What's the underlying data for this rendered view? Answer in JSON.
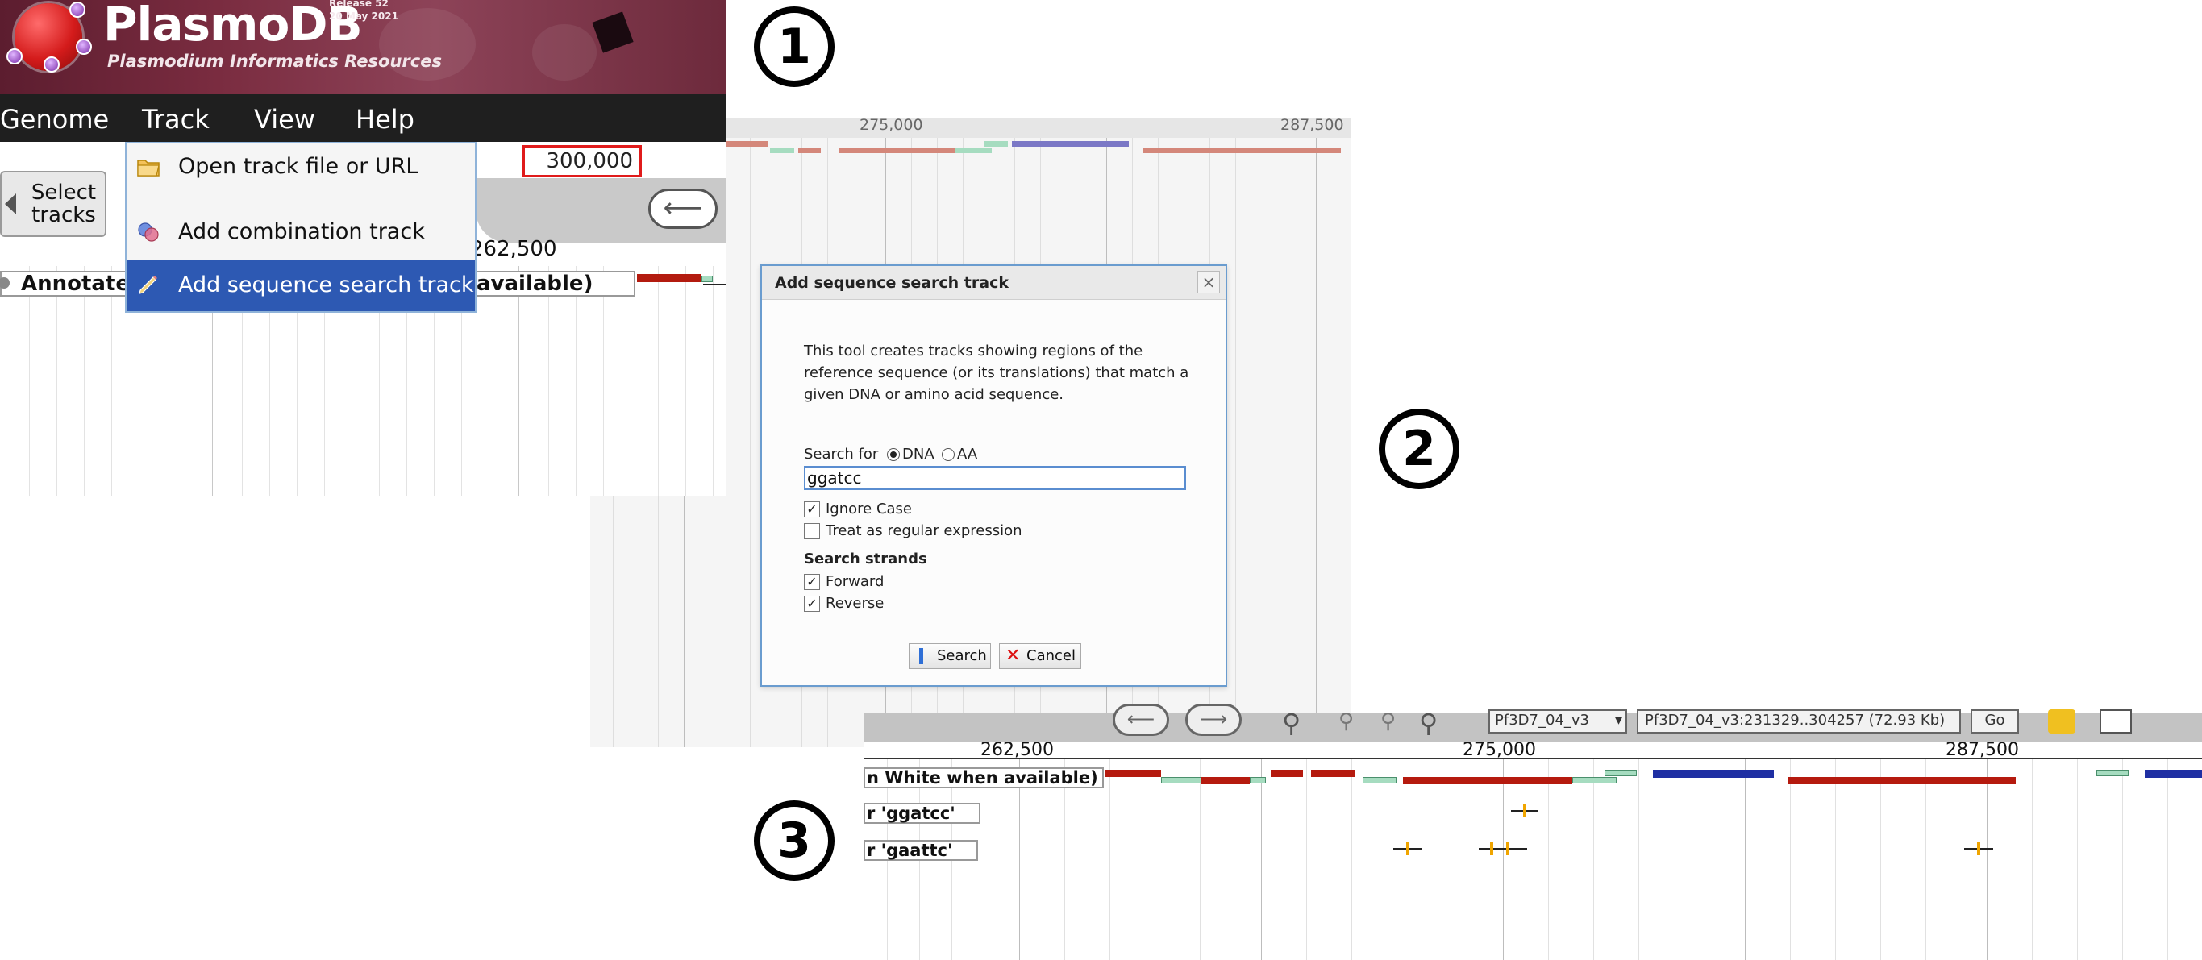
{
  "step_markers": [
    "1",
    "2",
    "3"
  ],
  "panel1": {
    "site": {
      "name": "PlasmoDB",
      "subtitle": "Plasmodium Informatics Resources",
      "release_line1": "Release 52",
      "release_line2": "20 May 2021"
    },
    "menubar": [
      "Genome",
      "Track",
      "View",
      "Help"
    ],
    "track_menu": {
      "items": [
        {
          "label": "Open track file or URL",
          "icon": "folder-icon"
        },
        {
          "label": "Add combination track",
          "icon": "combination-icon"
        },
        {
          "label": "Add sequence search track",
          "icon": "pencil-icon",
          "selected": true
        }
      ]
    },
    "select_tracks_label_1": "Select",
    "select_tracks_label_2": "tracks",
    "location_value": "300,000",
    "ruler_label": "262,500",
    "track_label_left": "Annotated",
    "track_label_right": "available)"
  },
  "panel2": {
    "ruler_ticks": [
      "275,000",
      "287,500"
    ],
    "dialog": {
      "title": "Add sequence search track",
      "close_glyph": "×",
      "description": "This tool creates tracks showing regions of the reference sequence (or its translations) that match a given DNA or amino acid sequence.",
      "search_for_label": "Search for",
      "search_type_options": [
        "DNA",
        "AA"
      ],
      "search_type_selected": "DNA",
      "query_value": "ggatcc",
      "ignore_case_label": "Ignore Case",
      "ignore_case_checked": true,
      "regex_label": "Treat as regular expression",
      "regex_checked": false,
      "strands_heading": "Search strands",
      "forward_label": "Forward",
      "forward_checked": true,
      "reverse_label": "Reverse",
      "reverse_checked": true,
      "search_button": "Search",
      "cancel_button": "Cancel"
    }
  },
  "panel3": {
    "toolbar": {
      "chromosome_select": "Pf3D7_04_v3",
      "location_field": "Pf3D7_04_v3:231329..304257 (72.93 Kb)",
      "go_button": "Go"
    },
    "ruler_ticks": [
      "262,500",
      "275,000",
      "287,500"
    ],
    "tracks": [
      {
        "label": "n White when available)"
      },
      {
        "label": "r 'ggatcc'"
      },
      {
        "label": "r 'gaattc'"
      }
    ]
  },
  "colors": {
    "banner": "#7a2c40",
    "menubar": "#1f1f1f",
    "menu_selected": "#2d59b3",
    "highlight_box": "#e01b1b",
    "gene_red": "#b51a0e",
    "gene_blue": "#1f2fa3",
    "gene_green": "#a6dcc0",
    "hit_marker": "#f0a500"
  }
}
